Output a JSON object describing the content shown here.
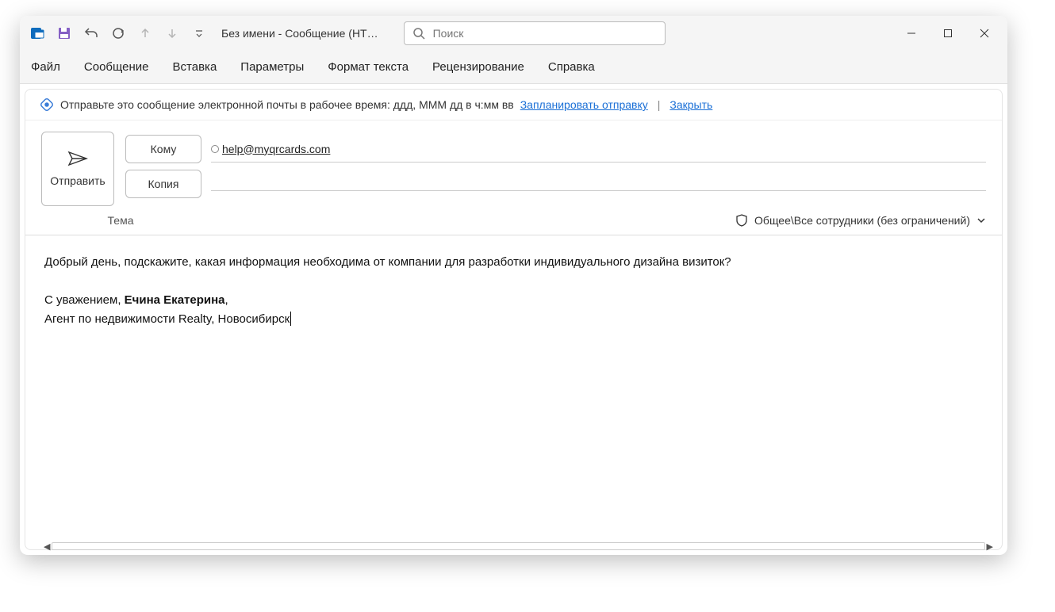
{
  "titlebar": {
    "window_title": "Без имени  -  Сообщение (HT…",
    "search_placeholder": "Поиск"
  },
  "ribbon": {
    "tabs": [
      "Файл",
      "Сообщение",
      "Вставка",
      "Параметры",
      "Формат текста",
      "Рецензирование",
      "Справка"
    ]
  },
  "infobar": {
    "message": "Отправьте это сообщение электронной почты в рабочее время: ддд, МММ дд в ч:мм вв",
    "schedule_link": "Запланировать отправку",
    "close_link": "Закрыть"
  },
  "compose": {
    "send_label": "Отправить",
    "to_label": "Кому",
    "cc_label": "Копия",
    "to_recipient": "help@myqrcards.com",
    "subject_label": "Тема",
    "sensitivity": "Общее\\Все сотрудники (без ограничений)"
  },
  "body": {
    "line1": "Добрый день, подскажите, какая информация необходима от компании для разработки индивидуального дизайна визиток?",
    "sig_prefix": "С  уважением, ",
    "sig_name": "Ечина Екатерина",
    "sig_comma": ",",
    "sig_line2": "Агент по недвижимости Realty, Новосибирск"
  }
}
